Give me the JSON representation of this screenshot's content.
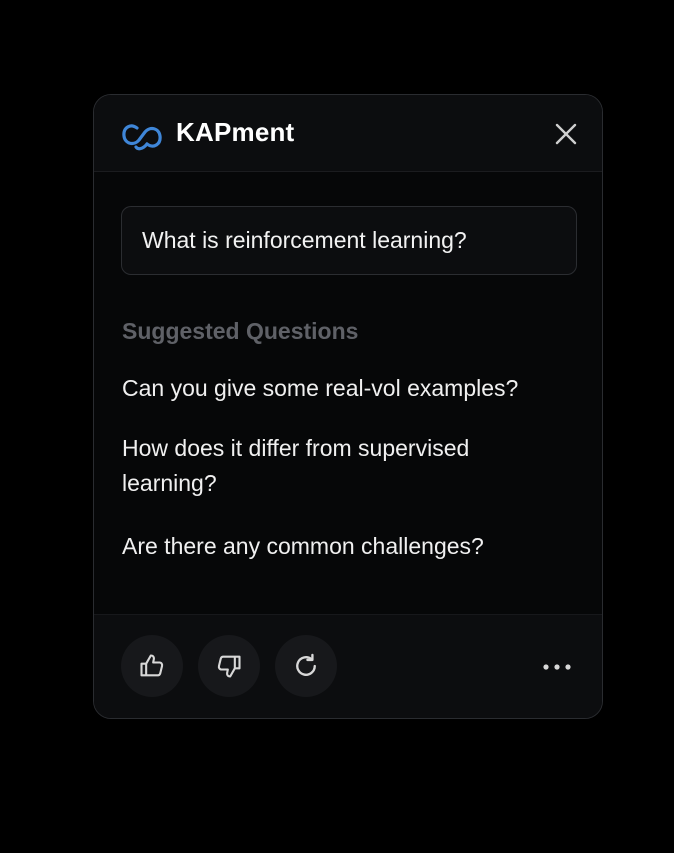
{
  "header": {
    "brand": "KAPment",
    "logo_icon": "kapment-logo-icon",
    "close_icon": "close-icon"
  },
  "query": {
    "text": "What is reinforcement learning?"
  },
  "suggestions": {
    "title": "Suggested Questions",
    "items": [
      "Can you give some real-vol examples?",
      "How does it differ from supervised learning?",
      "Are there any common challenges?"
    ]
  },
  "footer": {
    "actions": [
      "thumbs-up-icon",
      "thumbs-down-icon",
      "regenerate-icon"
    ],
    "more_icon": "more-icon"
  },
  "colors": {
    "background": "#000000",
    "panel": "#060708",
    "accent": "#3f86d8",
    "text": "#f0f0f0",
    "muted": "#5f6167"
  }
}
